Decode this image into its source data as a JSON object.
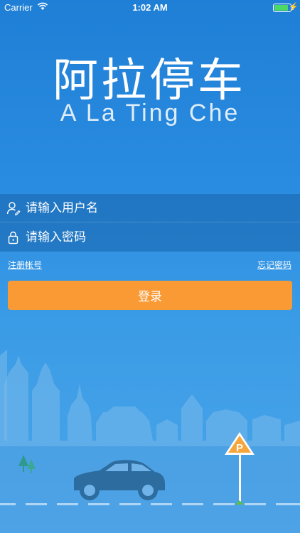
{
  "status_bar": {
    "carrier": "Carrier",
    "time": "1:02 AM",
    "battery_level": 0.85
  },
  "logo": {
    "chinese": "阿拉停车",
    "english": "A La Ting Che"
  },
  "login_form": {
    "username_placeholder": "请输入用户名",
    "password_placeholder": "请输入密码",
    "register_link": "注册帐号",
    "forgot_link": "忘记密码",
    "login_button": "登录"
  },
  "illustration": {
    "parking_sign": "P"
  },
  "colors": {
    "background_top": "#1f7fd6",
    "background_bottom": "#4aa6e8",
    "button": "#f99a35",
    "car": "#2d6c9f"
  }
}
